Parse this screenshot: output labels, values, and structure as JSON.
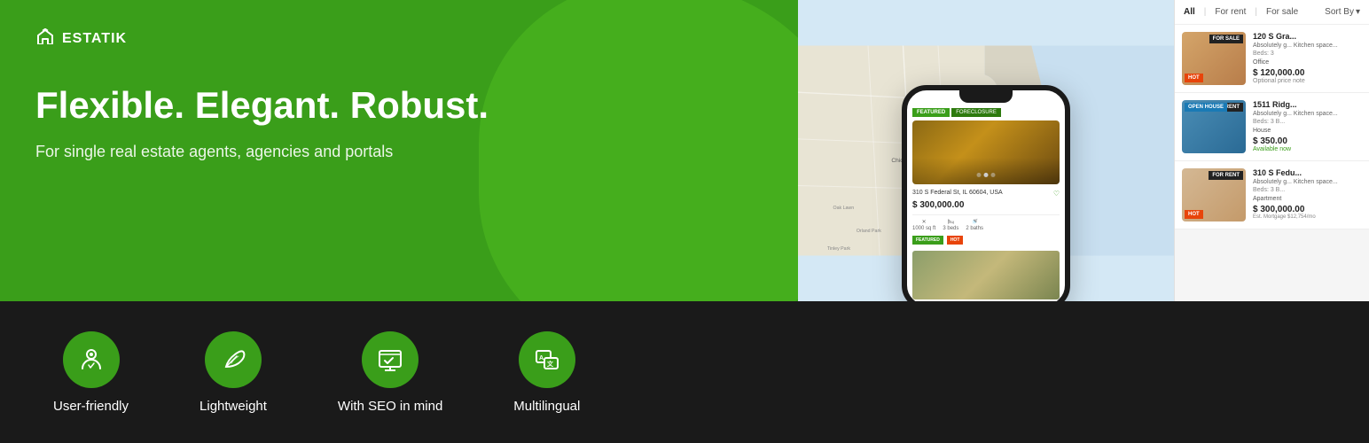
{
  "logo": {
    "icon": "⌂",
    "text": "ESTATIK"
  },
  "hero": {
    "title": "Flexible. Elegant. Robust.",
    "subtitle": "For single real estate agents, agencies and portals"
  },
  "phone": {
    "featured_label": "FEATURED",
    "foreclosure_label": "FORECLOSURE",
    "address": "310 S Federal St, IL 60604, USA",
    "price": "$ 300,000.00",
    "spec1": "1000 sq ft",
    "spec2": "3 beds",
    "spec3": "2 baths"
  },
  "panel": {
    "tab_all": "All",
    "tab_forrent": "For rent",
    "tab_forsale": "For sale",
    "sort_label": "Sort By",
    "properties": [
      {
        "id": 1,
        "title": "120 S Gra...",
        "desc": "Absolutely g... Kitchen space...",
        "specs": "Beds: 3",
        "type": "Office",
        "price": "$ 120,000.00",
        "price_note": "Optional price note",
        "badge": "FOR SALE",
        "hot": true,
        "featured": true,
        "thumb_style": "1"
      },
      {
        "id": 2,
        "title": "1511 Ridg...",
        "desc": "Absolutely g... Kitchen space...",
        "specs": "Beds: 3  B...",
        "type": "House",
        "price": "$ 350.00",
        "price_note": "Available now",
        "badge": "FOR RENT",
        "badge2": "OPEN HOUSE",
        "hot": false,
        "featured": false,
        "thumb_style": "2"
      },
      {
        "id": 3,
        "title": "310 S Fedu...",
        "desc": "Absolutely g... Kitchen space...",
        "specs": "Beds: 3  B...",
        "type": "Apartment",
        "price": "$ 300,000.00",
        "price_note": "Est. Mortgage $12,754/mo",
        "badge": "FOR RENT",
        "hot": true,
        "featured": true,
        "thumb_style": "3"
      }
    ]
  },
  "features": [
    {
      "id": "user-friendly",
      "label": "User-friendly",
      "icon": "👤"
    },
    {
      "id": "lightweight",
      "label": "Lightweight",
      "icon": "🌿"
    },
    {
      "id": "seo",
      "label": "With SEO in mind",
      "icon": "📊"
    },
    {
      "id": "multilingual",
      "label": "Multilingual",
      "icon": "🌐"
    }
  ]
}
